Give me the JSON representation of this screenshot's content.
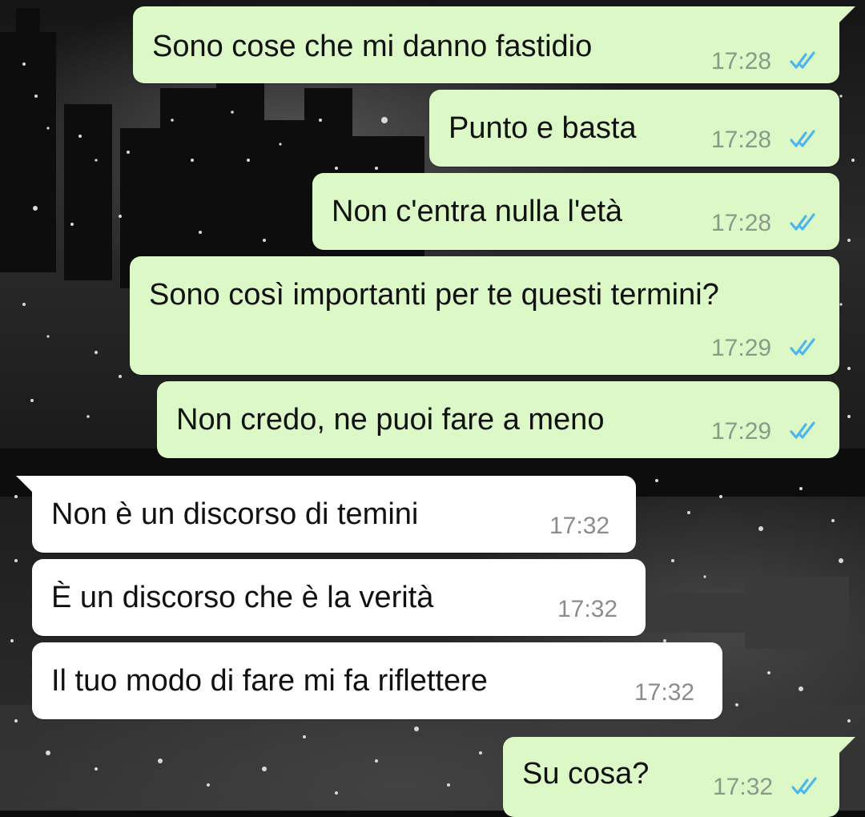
{
  "chat": {
    "theme": {
      "outgoing_bubble": "#dcf8c6",
      "incoming_bubble": "#ffffff",
      "read_tick": "#4fb6ec",
      "wallpaper": "night-city-black-and-white"
    },
    "messages": [
      {
        "direction": "outgoing",
        "text": "Sono cose che mi danno fastidio",
        "time": "17:28",
        "status": "read"
      },
      {
        "direction": "outgoing",
        "text": "Punto e basta",
        "time": "17:28",
        "status": "read"
      },
      {
        "direction": "outgoing",
        "text": "Non c'entra nulla l'età",
        "time": "17:28",
        "status": "read"
      },
      {
        "direction": "outgoing",
        "text": "Sono così importanti per te questi termini?",
        "time": "17:29",
        "status": "read"
      },
      {
        "direction": "outgoing",
        "text": "Non credo, ne puoi fare a meno",
        "time": "17:29",
        "status": "read"
      },
      {
        "direction": "incoming",
        "text": "Non è un discorso di temini",
        "time": "17:32"
      },
      {
        "direction": "incoming",
        "text": "È un discorso che è la verità",
        "time": "17:32"
      },
      {
        "direction": "incoming",
        "text": "Il tuo modo di fare mi fa riflettere",
        "time": "17:32"
      },
      {
        "direction": "outgoing",
        "text": "Su cosa?",
        "time": "17:32",
        "status": "read"
      }
    ]
  }
}
